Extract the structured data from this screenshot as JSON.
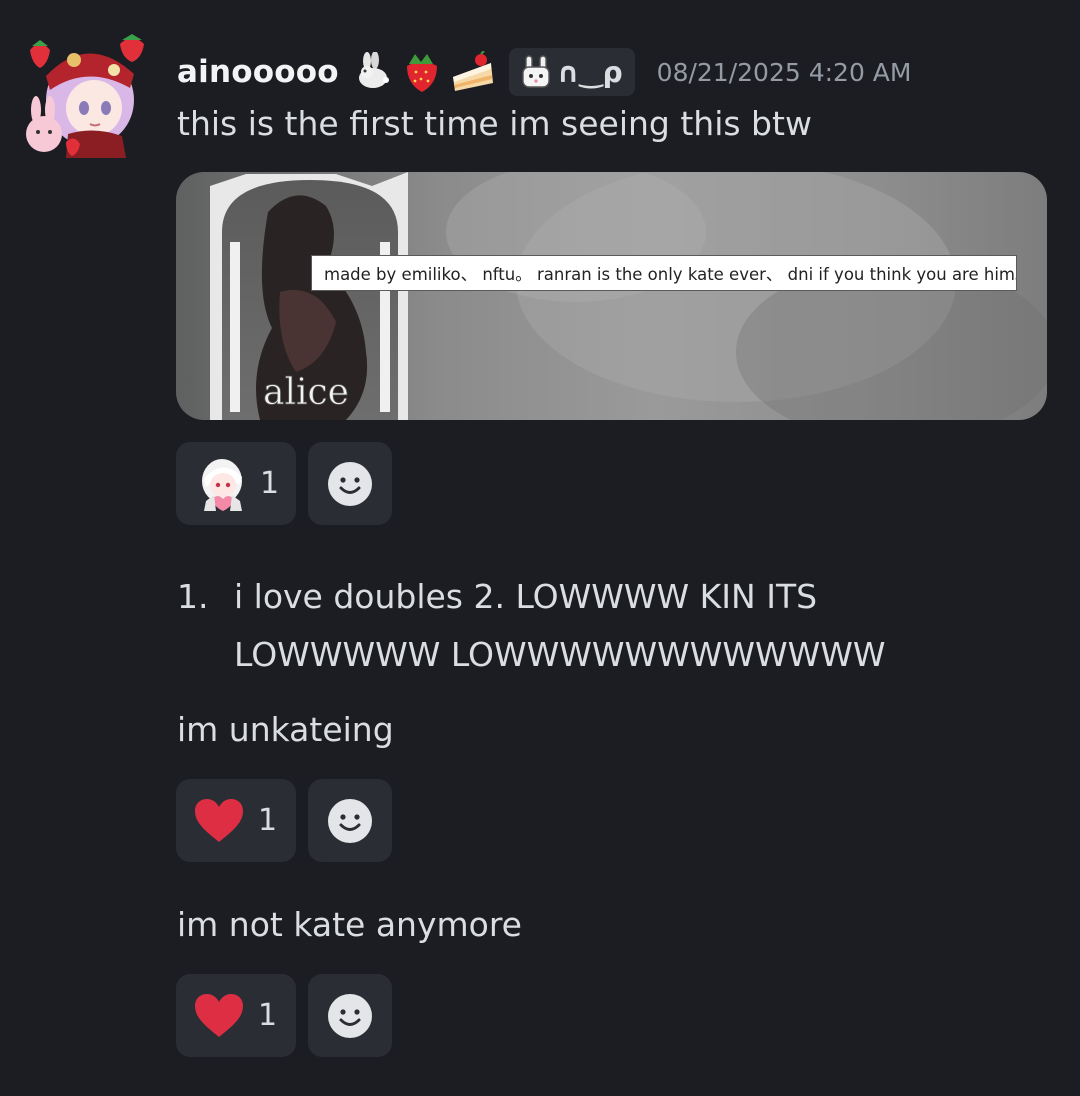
{
  "message": {
    "username": "ainooooo",
    "decorations": [
      "rabbit-icon",
      "strawberry-icon",
      "cake-icon"
    ],
    "tag": {
      "icon": "bunny-badge-icon",
      "text": "∩‿ρ"
    },
    "timestamp": "08/21/2025 4:20 AM",
    "text": "this is the first time im seeing this btw",
    "embed": {
      "overlay_text": "alice",
      "caption": "made by emiliko、 nftu。 ranran is the only kate ever、 dni if you think you are him。"
    },
    "reaction": {
      "emoji": "anime-girl-heart-icon",
      "count": "1"
    }
  },
  "list": {
    "marker": "1.",
    "line1": "i love doubles 2. LOWWWW KIN ITS",
    "line2": "LOWWWWW LOWWWWWWWWWWWW"
  },
  "msg2": {
    "text": "im unkateing",
    "reaction": {
      "emoji": "heart-icon",
      "count": "1"
    }
  },
  "msg3": {
    "text": "im not kate anymore",
    "reaction": {
      "emoji": "heart-icon",
      "count": "1"
    }
  },
  "colors": {
    "background": "#1c1d23",
    "reaction_bg": "#2b2d34",
    "text": "#dbdee1",
    "timestamp": "#949ba4",
    "heart": "#dd2e44"
  }
}
